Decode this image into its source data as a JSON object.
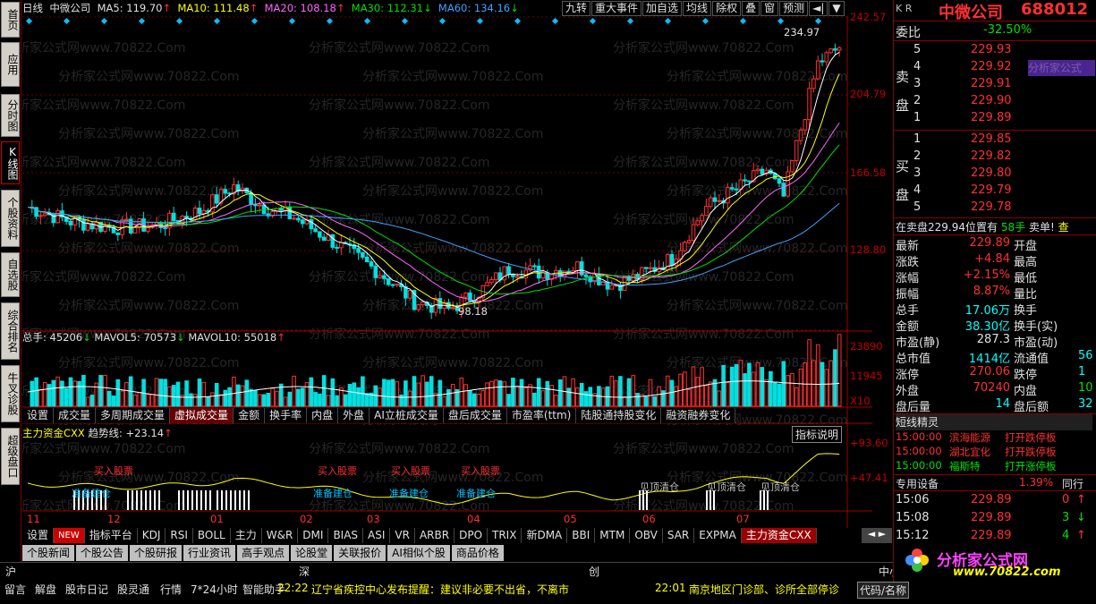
{
  "window": {
    "tab_daily": "日线",
    "stock_name": "中微公司"
  },
  "ma": {
    "ma5": "MA5: 119.70",
    "ma10": "MA10: 111.48",
    "ma20": "MA20: 108.18",
    "ma30": "MA30: 112.31",
    "ma60": "MA60: 134.16"
  },
  "toolbar": [
    "九转",
    "重大事件",
    "加自选",
    "均线",
    "除权",
    "叠",
    "窗",
    "预测"
  ],
  "left_tabs": [
    "首页",
    "应用",
    "分时图",
    "K线图",
    "个股资料",
    "自选股",
    "综合排名",
    "牛叉诊股",
    "超级盘口"
  ],
  "price_axis": [
    "242.57",
    "204.79",
    "166.58",
    "128.80"
  ],
  "price_marks": {
    "high": "234.97",
    "low": "98.18"
  },
  "volume": {
    "line": "总手: 45206",
    "mavol5": "MAVOL5: 70573",
    "mavol10": "MAVOL10: 55018",
    "axis_top": "23890",
    "axis_mid": "11945",
    "axis_unit": "X10"
  },
  "indicator_tabs": [
    "设置",
    "成交量",
    "多周期成交量",
    "虚拟成交量",
    "金额",
    "换手率",
    "内盘",
    "外盘",
    "AI立桩成交量",
    "盘后成交量",
    "市盈率(ttm)",
    "陆股通持股变化",
    "融资融券变化"
  ],
  "capital": {
    "title": "主力资金CXX",
    "trend": "趋势线: +23.14",
    "btn": "指标说明",
    "axis_top": "+93.60",
    "axis_mid": "+47.41",
    "buy_label": "买入股票",
    "lock_label": "准备建仓",
    "clear_label": "见顶清仓"
  },
  "months": [
    "11",
    "12",
    "01",
    "02",
    "03",
    "04",
    "05",
    "06",
    "07"
  ],
  "index_tabs": [
    "设置",
    "NEW",
    "指标平台",
    "KDJ",
    "RSI",
    "BOLL",
    "主力",
    "W&R",
    "DMI",
    "BIAS",
    "ASI",
    "VR",
    "ARBR",
    "DPO",
    "TRIX",
    "新DMA",
    "BBI",
    "MTM",
    "OBV",
    "SAR",
    "EXPMA",
    "主力资金CXX"
  ],
  "news_tabs": [
    "个股新闻",
    "个股公告",
    "个股研报",
    "行业资讯",
    "高手观点",
    "论股堂",
    "关联报价",
    "AI相似个股",
    "商品价格"
  ],
  "market": {
    "sh": "沪",
    "sz": "深",
    "cy": "创",
    "zx": "中小"
  },
  "bottom": {
    "items": [
      "留言",
      "解盘",
      "股市日记",
      "股灵通",
      "行情",
      "7*24小时",
      "智能助手"
    ],
    "news1_time": "22:22",
    "news1": "辽宁省疾控中心发布提醒：建议非必要不出省，不离市",
    "news2_time": "22:01",
    "news2": "南京地区门诊部、诊所全部停诊",
    "code_btn": "代码/名称"
  },
  "right": {
    "kr": "K R",
    "name": "中微公司",
    "code": "688012",
    "weibi_label": "委比",
    "weibi": "-32.50%",
    "sell_label": "卖盘",
    "buy_label": "买盘",
    "sell": [
      {
        "n": "5",
        "p": "229.93"
      },
      {
        "n": "4",
        "p": "229.92"
      },
      {
        "n": "3",
        "p": "229.91"
      },
      {
        "n": "2",
        "p": "229.90"
      },
      {
        "n": "1",
        "p": "229.89"
      }
    ],
    "buy": [
      {
        "n": "1",
        "p": "229.85"
      },
      {
        "n": "2",
        "p": "229.82"
      },
      {
        "n": "3",
        "p": "229.80"
      },
      {
        "n": "4",
        "p": "229.79"
      },
      {
        "n": "5",
        "p": "229.78"
      }
    ],
    "watermark": "分析家公式",
    "pos_line": "在卖盘229.94位置有",
    "pos_qty": "58手",
    "pos_action": "卖单!",
    "stats": [
      {
        "l": "最新",
        "v": "229.89",
        "l2": "开盘"
      },
      {
        "l": "涨跌",
        "v": "+4.84",
        "l2": "最高"
      },
      {
        "l": "涨幅",
        "v": "+2.15%",
        "l2": "最低"
      },
      {
        "l": "振幅",
        "v": "8.87%",
        "l2": "量比"
      },
      {
        "l": "总手",
        "v": "17.06万",
        "l2": "换手"
      },
      {
        "l": "金额",
        "v": "38.30亿",
        "l2": "换手(实)"
      },
      {
        "l": "市盈(静)",
        "v": "287.3",
        "l2": "市盈(动)"
      },
      {
        "l": "总市值",
        "v": "1414亿",
        "l2": "流通值",
        "v2": "56"
      },
      {
        "l": "涨停",
        "v": "270.06",
        "l2": "跌停",
        "v2": "1"
      },
      {
        "l": "外盘",
        "v": "70240",
        "l2": "内盘",
        "v2": "10"
      },
      {
        "l": "盘后量",
        "v": "14",
        "l2": "盘后额",
        "v2": "32"
      }
    ],
    "elf_title": "短线精灵",
    "elf": [
      {
        "t": "15:00:00",
        "s": "滨海能源",
        "a": "打开跌停板"
      },
      {
        "t": "15:00:00",
        "s": "湖北宜化",
        "a": "打开跌停板"
      },
      {
        "t": "15:00:00",
        "s": "福斯特",
        "a": "打开涨停板"
      }
    ],
    "sector": "专用设备",
    "sector_pct": "1.39%",
    "sector_btn": "同行",
    "ticks": [
      {
        "t": "15:06",
        "p": "229.89",
        "q": "0"
      },
      {
        "t": "15:08",
        "p": "229.89",
        "q": "3"
      },
      {
        "t": "15:12",
        "p": "229.89",
        "q": "4"
      }
    ],
    "logo_text": "分析家公式网",
    "logo_url": "www.70822.com"
  },
  "watermark_text": "分析家公式网www.70822.Com"
}
